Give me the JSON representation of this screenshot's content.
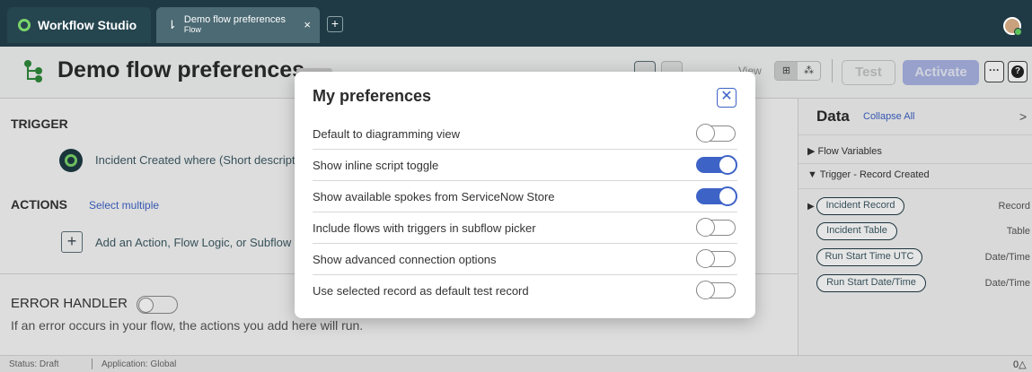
{
  "app": {
    "name": "Workflow Studio",
    "tab_title": "Demo flow preferences",
    "tab_subtitle": "Flow",
    "tab_close": "×",
    "add_tab": "+"
  },
  "header": {
    "title": "Demo flow preferences",
    "view_label": "View",
    "view_options": [
      "⊞",
      "⁂"
    ],
    "test_label": "Test",
    "activate_label": "Activate",
    "more_label": "···",
    "help_label": "?"
  },
  "main": {
    "trigger_title": "TRIGGER",
    "trigger_text": "Incident Created where (Short description",
    "actions_title": "ACTIONS",
    "select_multiple": "Select multiple",
    "add_symbol": "+",
    "add_text": "Add an Action, Flow Logic, or Subflow",
    "error_handler_title": "ERROR HANDLER",
    "error_handler_desc": "If an error occurs in your flow, the actions you add here will run."
  },
  "data_panel": {
    "title": "Data",
    "collapse_all": "Collapse All",
    "chevron": ">",
    "tree": [
      {
        "label": "▶ Flow Variables"
      },
      {
        "label": "▼ Trigger - Record Created"
      }
    ],
    "pills": [
      {
        "label": "Incident Record",
        "type": "Record"
      },
      {
        "label": "Incident Table",
        "type": "Table"
      },
      {
        "label": "Run Start Time UTC",
        "type": "Date/Time"
      },
      {
        "label": "Run Start Date/Time",
        "type": "Date/Time"
      }
    ]
  },
  "status": {
    "state": "Status: Draft",
    "application": "Application: Global",
    "right": "0△"
  },
  "modal": {
    "title": "My preferences",
    "close_symbol": "✕",
    "prefs": [
      {
        "label": "Default to diagramming view",
        "enabled": false
      },
      {
        "label": "Show inline script toggle",
        "enabled": true
      },
      {
        "label": "Show available spokes from ServiceNow Store",
        "enabled": true
      },
      {
        "label": "Include flows with triggers in subflow picker",
        "enabled": false
      },
      {
        "label": "Show advanced connection options",
        "enabled": false
      },
      {
        "label": "Use selected record as default test record",
        "enabled": false
      }
    ]
  },
  "colors": {
    "topbar": "#1f3a44",
    "accent_blue": "#3e63c7",
    "brand_green": "#7ad46a"
  }
}
